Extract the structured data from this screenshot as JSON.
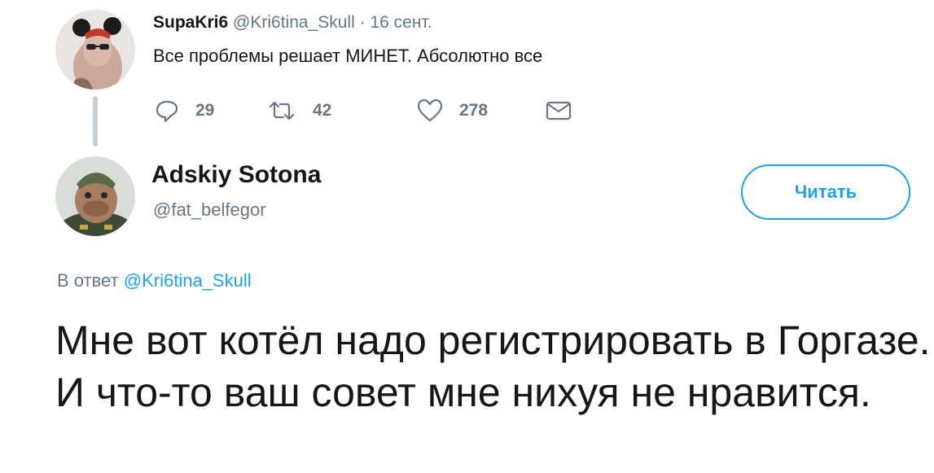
{
  "original_tweet": {
    "author_name": "SupaKri6",
    "author_handle": "@Kri6tina_Skull",
    "separator": "·",
    "date": "16 сент.",
    "text": "Все проблемы решает МИНЕТ. Абсолютно все",
    "actions": {
      "reply_count": "29",
      "retweet_count": "42",
      "like_count": "278"
    },
    "icons": [
      "reply-icon",
      "retweet-icon",
      "like-icon",
      "message-icon"
    ]
  },
  "reply_tweet": {
    "author_name": "Adskiy Sotona",
    "author_handle": "@fat_belfegor",
    "follow_label": "Читать",
    "reply_prefix": "В ответ",
    "reply_mention": "@Kri6tina_Skull",
    "text": "Мне вот котёл надо регистрировать в Горгазе. И что-то ваш совет мне нихуя не нравится."
  },
  "colors": {
    "accent": "#1da1f2",
    "secondary_text": "#657786",
    "primary_text": "#14171a",
    "thread_line": "#c4cfd6"
  }
}
